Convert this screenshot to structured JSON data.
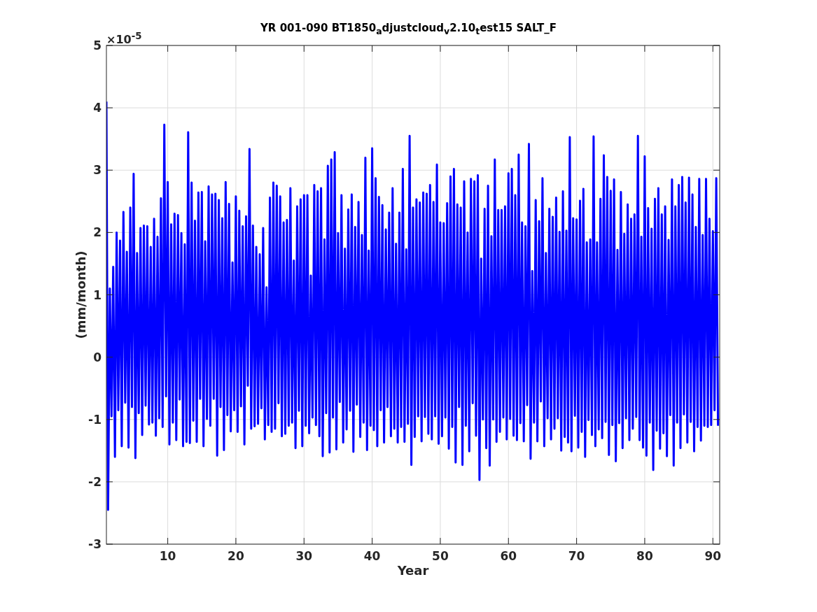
{
  "figure": {
    "y_multiplier": "×10$^{-5}$",
    "chart_data": {
      "type": "line",
      "title": "YR 001-090 BT1850$_{a}$djustcloud$_{v}$2.10$_{t}$est15 SALT_F",
      "xlabel": "Year",
      "ylabel": "(mm/month)",
      "xlim": [
        1,
        91
      ],
      "ylim": [
        -3,
        5
      ],
      "grid": true,
      "xticks": [
        10,
        20,
        30,
        40,
        50,
        60,
        70,
        80,
        90
      ],
      "yticks": [
        -3,
        -2,
        -1,
        0,
        1,
        2,
        3,
        4,
        5
      ],
      "x": [
        1,
        1.25,
        1.5,
        1.75,
        2,
        2.25,
        2.5,
        2.75,
        3,
        3.25,
        3.5,
        3.75,
        4,
        4.25,
        4.5,
        4.75,
        5,
        5.25,
        5.5,
        5.75,
        6,
        6.25,
        6.5,
        6.75,
        7,
        7.25,
        7.5,
        7.75,
        8,
        8.25,
        8.5,
        8.75,
        9,
        9.25,
        9.5,
        9.75,
        10,
        10.25,
        10.5,
        10.75,
        11,
        11.25,
        11.5,
        11.75,
        12,
        12.25,
        12.5,
        12.75,
        13,
        13.25,
        13.5,
        13.75,
        14,
        14.25,
        14.5,
        14.75,
        15,
        15.25,
        15.5,
        15.75,
        16,
        16.25,
        16.5,
        16.75,
        17,
        17.25,
        17.5,
        17.75,
        18,
        18.25,
        18.5,
        18.75,
        19,
        19.25,
        19.5,
        19.75,
        20,
        20.25,
        20.5,
        20.75,
        21,
        21.25,
        21.5,
        21.75,
        22,
        22.25,
        22.5,
        22.75,
        23,
        23.25,
        23.5,
        23.75,
        24,
        24.25,
        24.5,
        24.75,
        25,
        25.25,
        25.5,
        25.75,
        26,
        26.25,
        26.5,
        26.75,
        27,
        27.25,
        27.5,
        27.75,
        28,
        28.25,
        28.5,
        28.75,
        29,
        29.25,
        29.5,
        29.75,
        30,
        30.25,
        30.5,
        30.75,
        31,
        31.25,
        31.5,
        31.75,
        32,
        32.25,
        32.5,
        32.75,
        33,
        33.25,
        33.5,
        33.75,
        34,
        34.25,
        34.5,
        34.75,
        35,
        35.25,
        35.5,
        35.75,
        36,
        36.25,
        36.5,
        36.75,
        37,
        37.25,
        37.5,
        37.75,
        38,
        38.25,
        38.5,
        38.75,
        39,
        39.25,
        39.5,
        39.75,
        40,
        40.25,
        40.5,
        40.75,
        41,
        41.25,
        41.5,
        41.75,
        42,
        42.25,
        42.5,
        42.75,
        43,
        43.25,
        43.5,
        43.75,
        44,
        44.25,
        44.5,
        44.75,
        45,
        45.25,
        45.5,
        45.75,
        46,
        46.25,
        46.5,
        46.75,
        47,
        47.25,
        47.5,
        47.75,
        48,
        48.25,
        48.5,
        48.75,
        49,
        49.25,
        49.5,
        49.75,
        50,
        50.25,
        50.5,
        50.75,
        51,
        51.25,
        51.5,
        51.75,
        52,
        52.25,
        52.5,
        52.75,
        53,
        53.25,
        53.5,
        53.75,
        54,
        54.25,
        54.5,
        54.75,
        55,
        55.25,
        55.5,
        55.75,
        56,
        56.25,
        56.5,
        56.75,
        57,
        57.25,
        57.5,
        57.75,
        58,
        58.25,
        58.5,
        58.75,
        59,
        59.25,
        59.5,
        59.75,
        60,
        60.25,
        60.5,
        60.75,
        61,
        61.25,
        61.5,
        61.75,
        62,
        62.25,
        62.5,
        62.75,
        63,
        63.25,
        63.5,
        63.75,
        64,
        64.25,
        64.5,
        64.75,
        65,
        65.25,
        65.5,
        65.75,
        66,
        66.25,
        66.5,
        66.75,
        67,
        67.25,
        67.5,
        67.75,
        68,
        68.25,
        68.5,
        68.75,
        69,
        69.25,
        69.5,
        69.75,
        70,
        70.25,
        70.5,
        70.75,
        71,
        71.25,
        71.5,
        71.75,
        72,
        72.25,
        72.5,
        72.75,
        73,
        73.25,
        73.5,
        73.75,
        74,
        74.25,
        74.5,
        74.75,
        75,
        75.25,
        75.5,
        75.75,
        76,
        76.25,
        76.5,
        76.75,
        77,
        77.25,
        77.5,
        77.75,
        78,
        78.25,
        78.5,
        78.75,
        79,
        79.25,
        79.5,
        79.75,
        80,
        80.25,
        80.5,
        80.75,
        81,
        81.25,
        81.5,
        81.75,
        82,
        82.25,
        82.5,
        82.75,
        83,
        83.25,
        83.5,
        83.75,
        84,
        84.25,
        84.5,
        84.75,
        85,
        85.25,
        85.5,
        85.75,
        86,
        86.25,
        86.5,
        86.75,
        87,
        87.25,
        87.5,
        87.75,
        88,
        88.25,
        88.5,
        88.75,
        89,
        89.25,
        89.5,
        89.75,
        90,
        90.25,
        90.5,
        90.75
      ],
      "series": [
        {
          "color": "#0000ff",
          "values": [
            4.1,
            -2.45,
            1.1,
            -0.95,
            1.45,
            -1.6,
            2.0,
            -0.85,
            1.87,
            -1.43,
            2.33,
            -0.73,
            1.69,
            -1.45,
            2.4,
            -0.8,
            2.94,
            -1.62,
            1.67,
            -0.9,
            2.07,
            -1.25,
            2.11,
            -0.78,
            2.1,
            -1.08,
            1.77,
            -1.05,
            2.22,
            -1.26,
            1.93,
            -0.98,
            2.55,
            -1.12,
            3.73,
            -0.63,
            2.81,
            -1.4,
            2.13,
            -1.05,
            2.3,
            -1.33,
            2.28,
            -0.68,
            1.99,
            -1.43,
            1.81,
            -1.36,
            3.61,
            -1.38,
            2.8,
            -1.02,
            2.19,
            -1.36,
            2.64,
            -0.67,
            2.65,
            -1.43,
            1.86,
            -0.99,
            2.74,
            -1.1,
            2.61,
            -0.67,
            2.62,
            -1.58,
            2.52,
            -0.8,
            2.23,
            -1.49,
            2.81,
            -0.93,
            2.46,
            -1.19,
            1.52,
            -0.85,
            2.58,
            -1.2,
            2.35,
            -0.79,
            2.1,
            -1.4,
            2.26,
            -0.46,
            3.34,
            -1.15,
            2.11,
            -1.11,
            1.77,
            -1.07,
            1.65,
            -0.82,
            2.07,
            -1.32,
            1.12,
            -1.09,
            2.56,
            -1.2,
            2.8,
            -1.15,
            2.75,
            -0.74,
            2.58,
            -1.27,
            2.16,
            -1.23,
            2.2,
            -1.1,
            2.71,
            -1.05,
            1.55,
            -1.46,
            2.42,
            -0.86,
            2.53,
            -1.43,
            2.6,
            -1.1,
            2.6,
            -1.22,
            1.31,
            -0.97,
            2.76,
            -1.09,
            2.66,
            -1.27,
            2.71,
            -1.59,
            1.89,
            -0.9,
            3.07,
            -1.53,
            3.17,
            -0.97,
            3.29,
            -1.48,
            1.99,
            -0.72,
            2.6,
            -1.37,
            1.74,
            -1.16,
            2.37,
            -0.86,
            2.61,
            -1.52,
            2.09,
            -0.76,
            2.49,
            -1.28,
            1.96,
            -1.05,
            3.2,
            -1.49,
            1.71,
            -1.1,
            3.35,
            -1.17,
            2.87,
            -1.43,
            2.57,
            -0.85,
            2.44,
            -1.37,
            2.05,
            -0.8,
            2.32,
            -1.27,
            2.71,
            -1.15,
            1.82,
            -1.37,
            2.32,
            -1.12,
            3.02,
            -1.36,
            1.73,
            -1.07,
            3.55,
            -1.73,
            2.4,
            -1.28,
            2.53,
            -0.95,
            2.48,
            -1.35,
            2.64,
            -0.96,
            2.62,
            -1.23,
            2.76,
            -1.32,
            2.49,
            -0.95,
            3.09,
            -1.39,
            2.16,
            -1.27,
            2.15,
            -0.97,
            2.47,
            -1.47,
            2.9,
            -1.12,
            3.02,
            -1.69,
            2.45,
            -0.8,
            2.4,
            -1.73,
            2.82,
            -1.1,
            2.0,
            -1.51,
            2.86,
            -0.74,
            2.82,
            -1.26,
            2.92,
            -1.97,
            1.58,
            -1.0,
            2.38,
            -1.46,
            2.75,
            -1.74,
            1.94,
            -1.0,
            3.17,
            -1.36,
            2.36,
            -1.2,
            2.36,
            -0.97,
            2.42,
            -1.32,
            2.95,
            -0.99,
            3.02,
            -1.26,
            2.6,
            -1.33,
            3.25,
            -1.06,
            2.16,
            -1.35,
            2.1,
            -0.77,
            3.42,
            -1.63,
            1.38,
            -1.05,
            2.52,
            -1.35,
            2.18,
            -0.71,
            2.87,
            -1.43,
            1.67,
            -0.98,
            2.38,
            -1.32,
            2.25,
            -1.15,
            2.56,
            -0.98,
            2.01,
            -1.5,
            2.66,
            -1.28,
            2.03,
            -1.37,
            3.53,
            -1.51,
            2.23,
            -0.94,
            2.21,
            -1.45,
            2.51,
            -1.2,
            2.7,
            -1.6,
            1.84,
            -1.01,
            1.89,
            -1.25,
            3.54,
            -1.43,
            1.84,
            -1.16,
            2.54,
            -1.3,
            3.24,
            -1.04,
            2.89,
            -1.57,
            2.67,
            -1.09,
            2.85,
            -1.67,
            1.72,
            -1.06,
            2.65,
            -1.46,
            1.98,
            -0.98,
            2.45,
            -1.33,
            2.22,
            -1.15,
            2.29,
            -0.96,
            3.55,
            -1.33,
            1.93,
            -1.45,
            3.22,
            -1.58,
            2.39,
            -1.05,
            2.06,
            -1.81,
            2.54,
            -1.18,
            2.71,
            -1.47,
            2.29,
            -1.22,
            2.42,
            -1.59,
            1.88,
            -0.93,
            2.85,
            -1.74,
            2.42,
            -1.05,
            2.76,
            -1.46,
            2.89,
            -0.92,
            2.48,
            -1.37,
            2.88,
            -1.04,
            2.61,
            -1.51,
            2.09,
            -1.12,
            2.86,
            -1.34,
            1.96,
            -1.1,
            2.86,
            -1.12,
            2.22,
            -1.09,
            2.02,
            -0.85,
            2.87,
            -1.1
          ]
        }
      ]
    }
  }
}
